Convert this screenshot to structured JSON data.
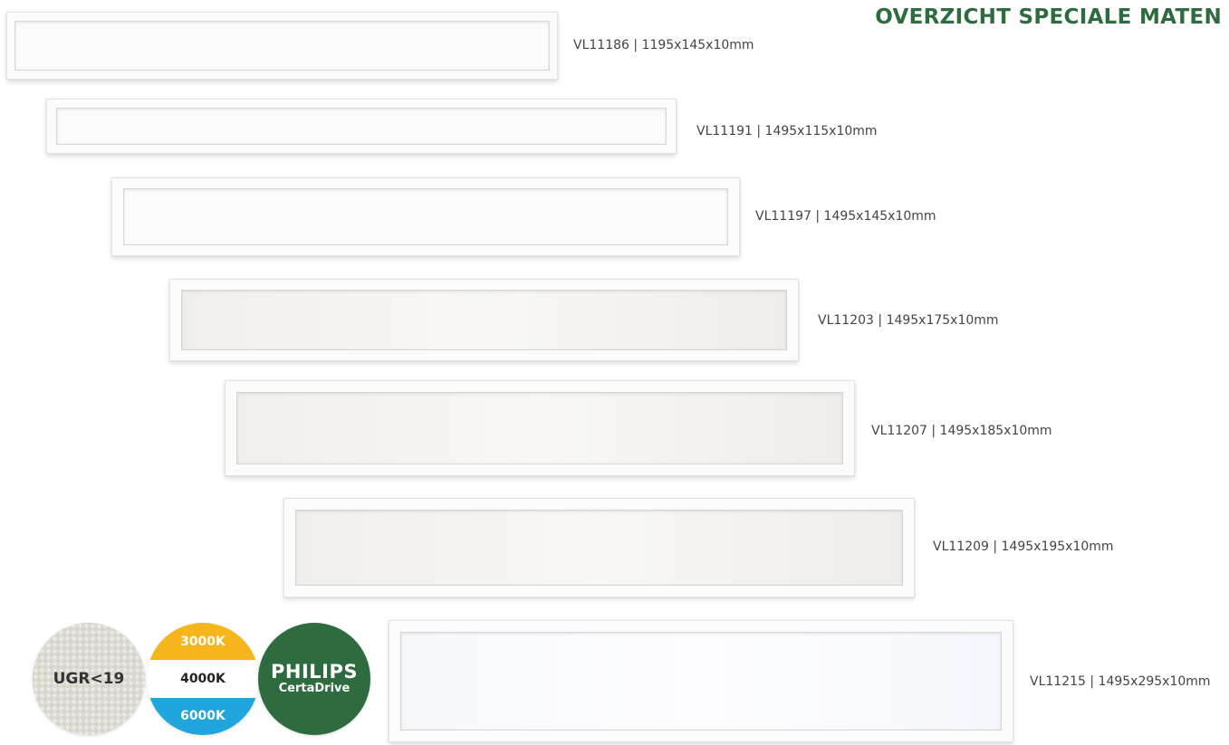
{
  "page": {
    "title": "OVERZICHT SPECIALE MATEN"
  },
  "panels": [
    {
      "label": "VL11186 | 1195x145x10mm",
      "tint": "cool"
    },
    {
      "label": "VL11191 | 1495x115x10mm",
      "tint": "cool"
    },
    {
      "label": "VL11197 | 1495x145x10mm",
      "tint": "cool"
    },
    {
      "label": "VL11203 | 1495x175x10mm",
      "tint": "warm"
    },
    {
      "label": "VL11207 | 1495x185x10mm",
      "tint": "warm"
    },
    {
      "label": "VL11209 | 1495x195x10mm",
      "tint": "warm"
    },
    {
      "label": "VL11215 | 1495x295x10mm",
      "tint": "cool"
    }
  ],
  "badges": {
    "ugr": {
      "label": "UGR<19"
    },
    "cct": {
      "warm": "3000K",
      "neutral": "4000K",
      "cool": "6000K"
    },
    "philips": {
      "brand": "PHILIPS",
      "product": "CertaDrive"
    }
  },
  "colors": {
    "title": "#2e6b3e",
    "philips_badge": "#2e6b3e",
    "cct_warm": "#f7b51c",
    "cct_cool": "#20a6dc"
  }
}
